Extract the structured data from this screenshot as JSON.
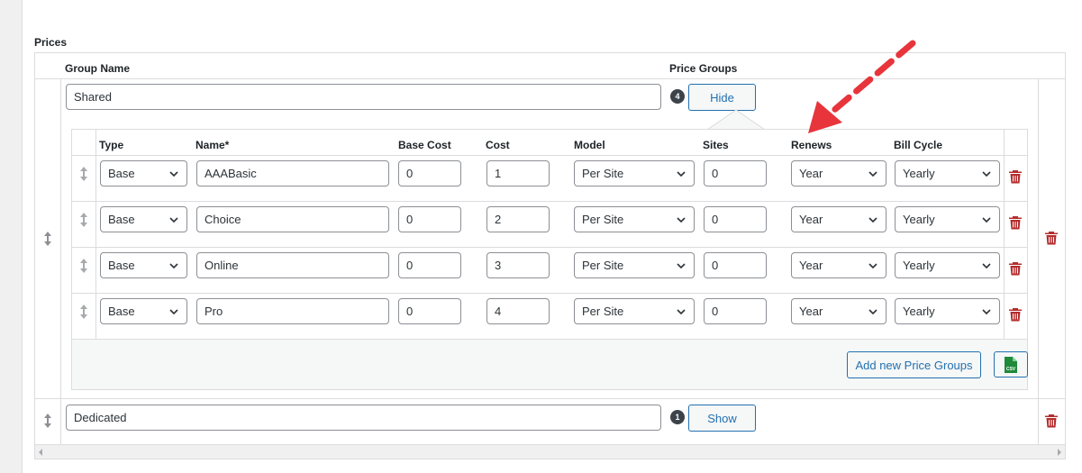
{
  "section": {
    "title": "Prices"
  },
  "headers": {
    "group_name": "Group Name",
    "price_groups": "Price Groups"
  },
  "groups": [
    {
      "name": "Shared",
      "count": "4",
      "toggle_label": "Hide"
    },
    {
      "name": "Dedicated",
      "count": "1",
      "toggle_label": "Show"
    }
  ],
  "price_table": {
    "columns": [
      "Type",
      "Name*",
      "Base Cost",
      "Cost",
      "Model",
      "Sites",
      "Renews",
      "Bill Cycle"
    ],
    "rows": [
      {
        "type": "Base",
        "name": "AAABasic",
        "base_cost": "0",
        "cost": "1",
        "model": "Per Site",
        "sites": "0",
        "renews": "Year",
        "bill_cycle": "Yearly"
      },
      {
        "type": "Base",
        "name": "Choice",
        "base_cost": "0",
        "cost": "2",
        "model": "Per Site",
        "sites": "0",
        "renews": "Year",
        "bill_cycle": "Yearly"
      },
      {
        "type": "Base",
        "name": "Online",
        "base_cost": "0",
        "cost": "3",
        "model": "Per Site",
        "sites": "0",
        "renews": "Year",
        "bill_cycle": "Yearly"
      },
      {
        "type": "Base",
        "name": "Pro",
        "base_cost": "0",
        "cost": "4",
        "model": "Per Site",
        "sites": "0",
        "renews": "Year",
        "bill_cycle": "Yearly"
      }
    ],
    "add_button_label": "Add new Price Groups",
    "csv_label": "CSV"
  },
  "colors": {
    "accent": "#2271b1",
    "danger": "#b32d2e",
    "csv_green": "#1e8a3a",
    "annotation_arrow": "#e8343b"
  },
  "icons": {
    "drag": "drag-handle-icon",
    "delete": "trash-icon",
    "dropdown": "chevron-down-icon",
    "csv": "csv-file-icon"
  }
}
